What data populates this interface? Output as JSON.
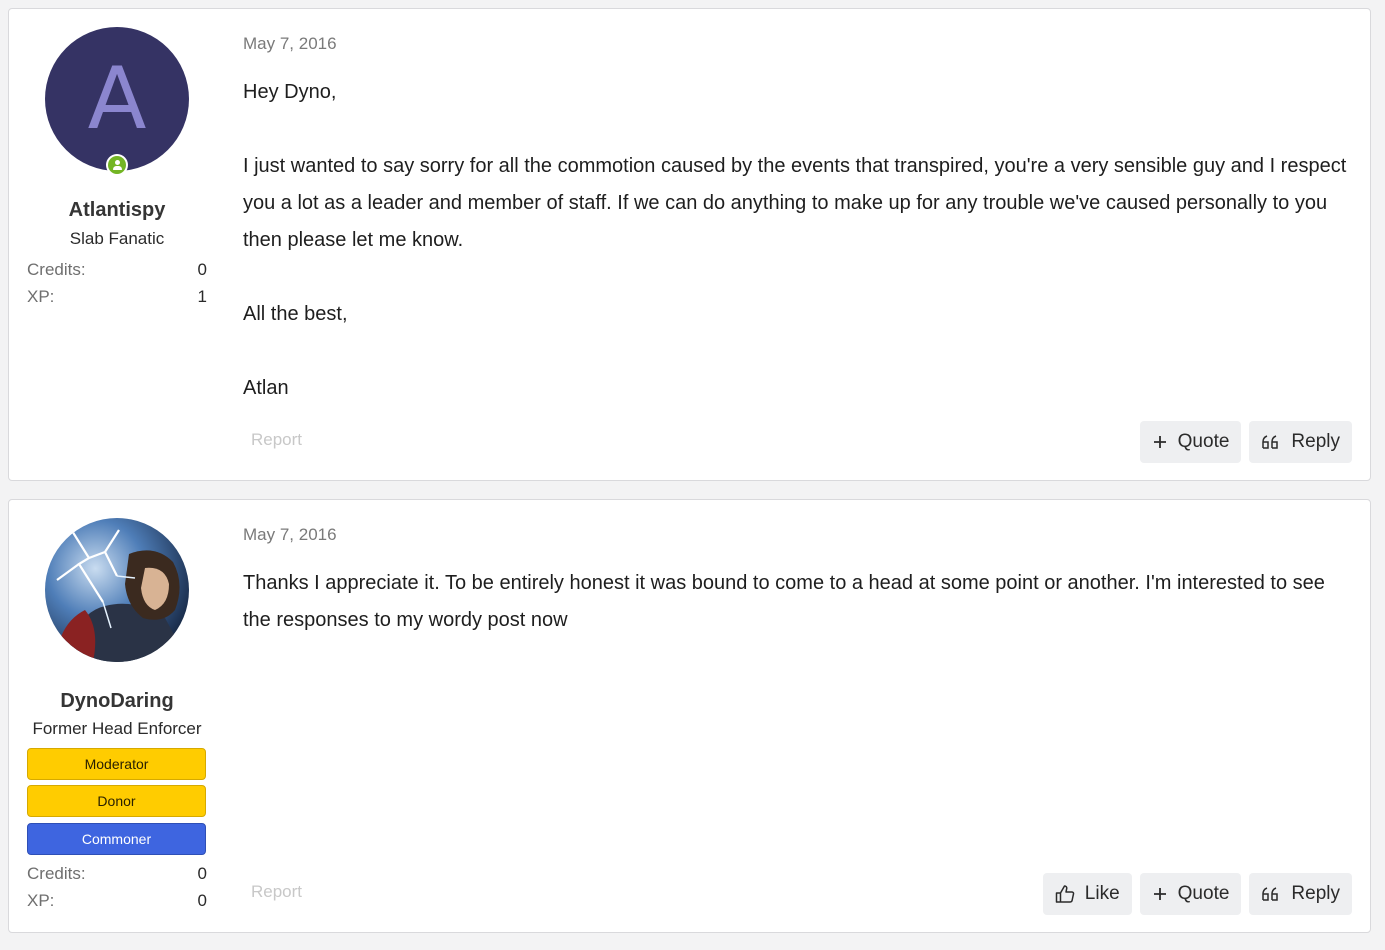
{
  "posts": [
    {
      "author": {
        "avatar_letter": "A",
        "avatar_color": "#353364",
        "online_icon": "online-status-icon",
        "name": "Atlantispy",
        "title": "Slab Fanatic",
        "stats": [
          {
            "label": "Credits:",
            "value": "0"
          },
          {
            "label": "XP:",
            "value": "1"
          }
        ]
      },
      "date": "May 7, 2016",
      "body": [
        "Hey Dyno,",
        "I just wanted to say sorry for all the commotion caused by the events that transpired, you're a very sensible guy and I respect you a lot as a leader and member of staff. If we can do anything to make up for any trouble we've caused personally to you then please let me know.",
        "All the best,",
        "Atlan"
      ],
      "report_label": "Report",
      "actions": [
        {
          "icon": "plus-icon",
          "label": "Quote"
        },
        {
          "icon": "quote-icon",
          "label": "Reply"
        }
      ]
    },
    {
      "author": {
        "avatar_description": "avatar-image",
        "name": "DynoDaring",
        "title": "Former Head Enforcer",
        "banners": [
          {
            "label": "Moderator",
            "color": "#ffcc00"
          },
          {
            "label": "Donor",
            "color": "#ffcc00"
          },
          {
            "label": "Commoner",
            "color": "#3e65e0"
          }
        ],
        "stats": [
          {
            "label": "Credits:",
            "value": "0"
          },
          {
            "label": "XP:",
            "value": "0"
          }
        ]
      },
      "date": "May 7, 2016",
      "body": [
        "Thanks I appreciate it. To be entirely honest it was bound to come to a head at some point or another. I'm interested to see the responses to my wordy post now"
      ],
      "report_label": "Report",
      "actions": [
        {
          "icon": "thumbs-up-icon",
          "label": "Like"
        },
        {
          "icon": "plus-icon",
          "label": "Quote"
        },
        {
          "icon": "quote-icon",
          "label": "Reply"
        }
      ]
    }
  ]
}
